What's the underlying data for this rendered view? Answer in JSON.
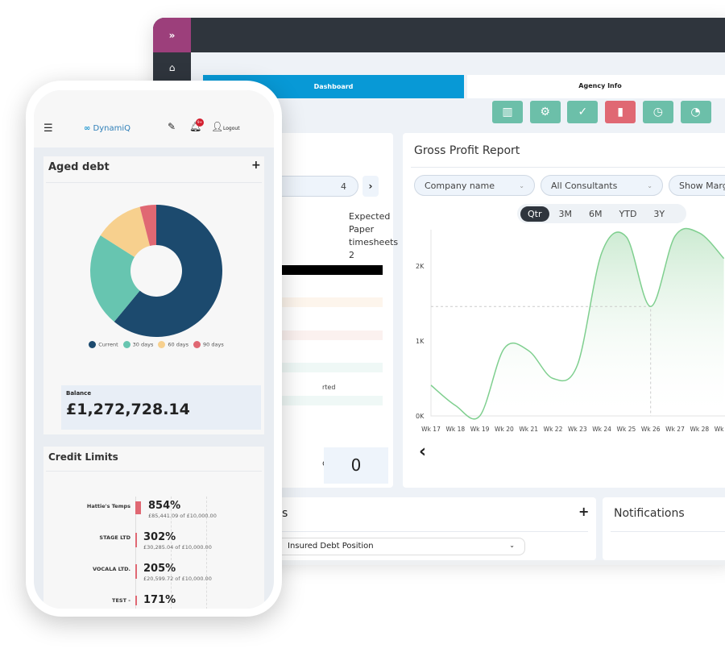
{
  "desktop": {
    "expand_icon": "double-chevron-right-icon",
    "home_icon": "home-icon",
    "tabs": [
      {
        "label": "Dashboard",
        "active": true
      },
      {
        "label": "Agency Info",
        "active": false
      }
    ],
    "action_icons": [
      {
        "icon": "building-icon",
        "color": "#6cbfa9",
        "glyph": "▥"
      },
      {
        "icon": "user-gear-icon",
        "color": "#6cbfa9",
        "glyph": "⚙"
      },
      {
        "icon": "user-check-icon",
        "color": "#6cbfa9",
        "glyph": "✓"
      },
      {
        "icon": "document-icon",
        "color": "#e06873",
        "glyph": "▮"
      },
      {
        "icon": "clock-icon",
        "color": "#6cbfa9",
        "glyph": "◷"
      },
      {
        "icon": "user-clock-icon",
        "color": "#6cbfa9",
        "glyph": "◔"
      }
    ],
    "left_card": {
      "date_field": "4",
      "expected_label": "Expected",
      "paper_label": "Paper timesheets",
      "paper_value": "2",
      "row_partial": "rted",
      "pending_partial": "ding",
      "pending_value": "0"
    },
    "gross_profit": {
      "title": "Gross Profit Report",
      "filters": [
        "Company name",
        "All Consultants",
        "Show Marg"
      ],
      "periods": [
        "Qtr",
        "3M",
        "6M",
        "YTD",
        "3Y"
      ],
      "active_period": "Qtr",
      "back_icon": "chevron-left-icon"
    },
    "bottom_left": {
      "title_partial": "s",
      "add_icon": "plus-icon",
      "select_value": "Insured Debt Position"
    },
    "notifications": {
      "title": "Notifications"
    }
  },
  "phone": {
    "menu_icon": "hamburger-icon",
    "logo": "DynamiQ",
    "edit_icon": "pencil-icon",
    "bell_icon": "bell-icon",
    "notification_badge": "9+",
    "logout": "Logout",
    "aged_debt": {
      "title": "Aged debt",
      "add_icon": "plus-icon",
      "balance_label": "Balance",
      "balance_value": "£1,272,728.14"
    },
    "credit_limits": {
      "title": "Credit Limits",
      "items": [
        {
          "name": "Hattie's Temps",
          "pct": "854%",
          "detail": "£85,441.09 of £10,000.00"
        },
        {
          "name": "STAGE LTD",
          "pct": "302%",
          "detail": "£30,285.04 of £10,000.00"
        },
        {
          "name": "VOCALA LTD.",
          "pct": "205%",
          "detail": "£20,599.72 of £10,000.00"
        },
        {
          "name": "TEST -",
          "pct": "171%",
          "detail": ""
        }
      ]
    }
  },
  "chart_data": [
    {
      "type": "pie",
      "title": "Aged debt",
      "categories": [
        "Current",
        "30 days",
        "60 days",
        "90 days"
      ],
      "values": [
        61,
        23,
        12,
        4
      ],
      "colors": [
        "#1c4a6e",
        "#67c5b0",
        "#f7d08e",
        "#e06873"
      ],
      "legend": "bottom",
      "donut": true
    },
    {
      "type": "area",
      "title": "Gross Profit Report",
      "categories": [
        "Wk 17",
        "Wk 18",
        "Wk 19",
        "Wk 20",
        "Wk 21",
        "Wk 22",
        "Wk 23",
        "Wk 24",
        "Wk 25",
        "Wk 26",
        "Wk 27",
        "Wk 28",
        "Wk 29"
      ],
      "values": [
        410,
        140,
        0,
        900,
        870,
        500,
        680,
        2180,
        2390,
        1460,
        2400,
        2440,
        2100
      ],
      "yticks": [
        "0K",
        "1K",
        "2K"
      ],
      "ylim": [
        0,
        2500
      ],
      "color": "#7fcf8f",
      "highlight": "Wk 26"
    }
  ]
}
